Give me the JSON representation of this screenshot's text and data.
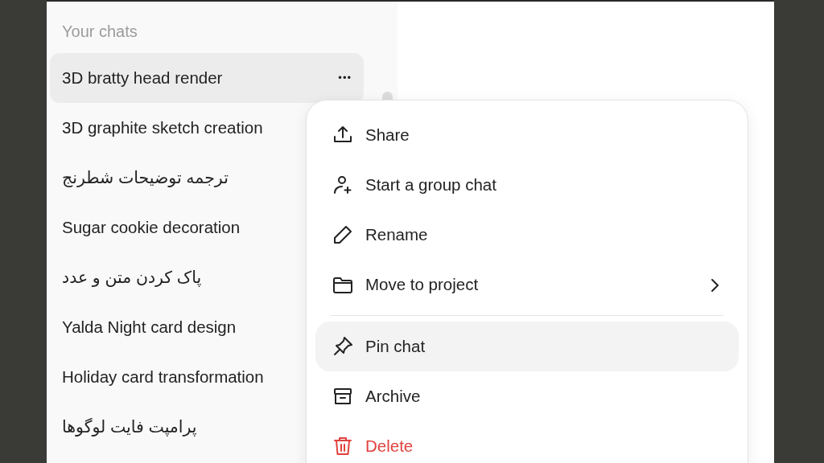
{
  "sidebar": {
    "heading": "Your chats",
    "chats": [
      {
        "title": "3D bratty head render",
        "selected": true
      },
      {
        "title": "3D graphite sketch creation",
        "selected": false
      },
      {
        "title": "ترجمه توضیحات شطرنج",
        "selected": false
      },
      {
        "title": "Sugar cookie decoration",
        "selected": false
      },
      {
        "title": "پاک کردن متن و عدد",
        "selected": false
      },
      {
        "title": "Yalda Night card design",
        "selected": false
      },
      {
        "title": "Holiday card transformation",
        "selected": false
      },
      {
        "title": "پرامپت فایت لوگوها",
        "selected": false
      }
    ],
    "more_button": "•••"
  },
  "menu": {
    "groups": [
      [
        {
          "label": "Share",
          "kind": "action",
          "selected": false,
          "submenu": false
        },
        {
          "label": "Start a group chat",
          "kind": "action",
          "selected": false,
          "submenu": false
        },
        {
          "label": "Rename",
          "kind": "action",
          "selected": false,
          "submenu": false
        },
        {
          "label": "Move to project",
          "kind": "action",
          "selected": false,
          "submenu": true
        }
      ],
      [
        {
          "label": "Pin chat",
          "kind": "action",
          "selected": true,
          "submenu": false
        },
        {
          "label": "Archive",
          "kind": "action",
          "selected": false,
          "submenu": false
        },
        {
          "label": "Delete",
          "kind": "danger",
          "selected": false,
          "submenu": false
        }
      ]
    ]
  }
}
